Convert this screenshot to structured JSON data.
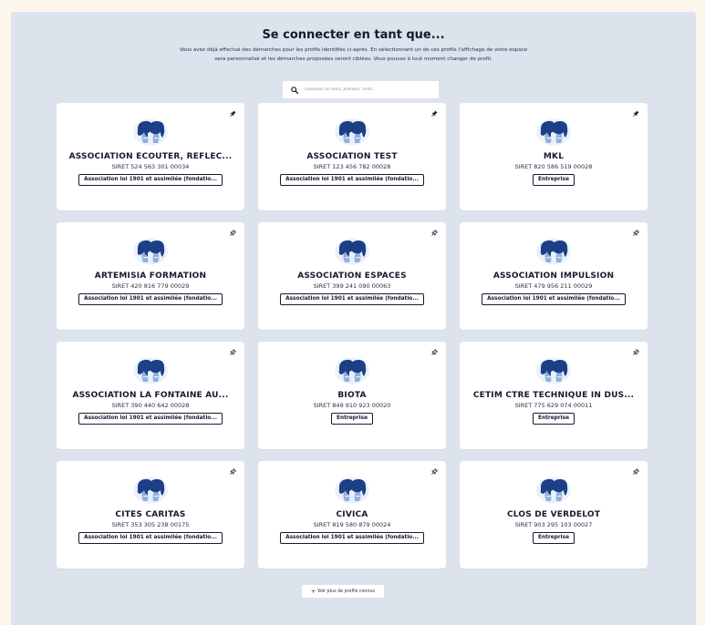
{
  "page": {
    "title": "Se connecter en tant que...",
    "description_line1": "Vous avez déjà effectué des démarches pour les profils identifiés ci-après. En sélectionnant un de ces profils l'affichage de votre espace",
    "description_line2": "sera personnalisé et les démarches proposées seront ciblées. Vous pouvez à tout moment changer de profil."
  },
  "search": {
    "placeholder": "Saisissez un nom, prénom, siret..."
  },
  "colors": {
    "avatar_dark": "#1c3f86",
    "avatar_light": "#8fb0e0",
    "panel": "#dde3ec",
    "page_bg": "#fdf6ea"
  },
  "profiles": [
    {
      "name": "ASSOCIATION ECOUTER, REFLEC...",
      "siret": "SIRET 524 563 301 00034",
      "type": "Association loi 1901 et assimilée (fondatio...",
      "pinned": true
    },
    {
      "name": "ASSOCIATION TEST",
      "siret": "SIRET 123 456 782 00028",
      "type": "Association loi 1901 et assimilée (fondatio...",
      "pinned": true
    },
    {
      "name": "MKL",
      "siret": "SIRET 820 586 519 00028",
      "type": "Entreprise",
      "pinned": true
    },
    {
      "name": "ARTEMISIA FORMATION",
      "siret": "SIRET 420 816 779 00029",
      "type": "Association loi 1901 et assimilée (fondatio...",
      "pinned": false
    },
    {
      "name": "ASSOCIATION ESPACES",
      "siret": "SIRET 399 241 090 00063",
      "type": "Association loi 1901 et assimilée (fondatio...",
      "pinned": false
    },
    {
      "name": "ASSOCIATION IMPULSION",
      "siret": "SIRET 479 956 211 00029",
      "type": "Association loi 1901 et assimilée (fondatio...",
      "pinned": false
    },
    {
      "name": "ASSOCIATION LA FONTAINE AU...",
      "siret": "SIRET 390 440 642 00028",
      "type": "Association loi 1901 et assimilée (fondatio...",
      "pinned": false
    },
    {
      "name": "BIOTA",
      "siret": "SIRET 848 910 923 00020",
      "type": "Entreprise",
      "pinned": false
    },
    {
      "name": "CETIM CTRE TECHNIQUE IN DUS...",
      "siret": "SIRET 775 629 074 00011",
      "type": "Entreprise",
      "pinned": false
    },
    {
      "name": "CITES CARITAS",
      "siret": "SIRET 353 305 238 00175",
      "type": "Association loi 1901 et assimilée (fondatio...",
      "pinned": false
    },
    {
      "name": "CIVICA",
      "siret": "SIRET 819 580 879 00024",
      "type": "Association loi 1901 et assimilée (fondatio...",
      "pinned": false
    },
    {
      "name": "CLOS DE VERDELOT",
      "siret": "SIRET 903 295 103 00027",
      "type": "Entreprise",
      "pinned": false
    }
  ],
  "more_button": {
    "label": "Voir plus de profils connus"
  }
}
